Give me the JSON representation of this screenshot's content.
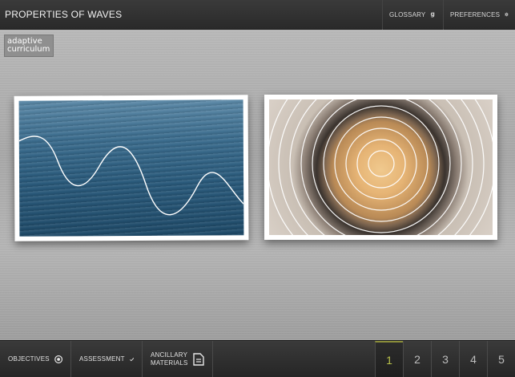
{
  "header": {
    "title": "PROPERTIES OF WAVES",
    "glossary_label": "GLOSSARY",
    "preferences_label": "PREFERENCES",
    "glossary_icon": "glossary-g-icon",
    "preferences_icon": "gear-icon"
  },
  "logo": {
    "line1": "adaptive",
    "line2": "curriculum"
  },
  "content": {
    "images": [
      {
        "name": "ocean-wave-photo",
        "description_icon": "sine-wave-overlay"
      },
      {
        "name": "speaker-sound-waves-photo",
        "description_icon": "concentric-rings-overlay"
      }
    ]
  },
  "footer": {
    "objectives_label": "OBJECTIVES",
    "assessment_label": "ASSESSMENT",
    "ancillary_line1": "ANCILLARY",
    "ancillary_line2": "MATERIALS",
    "pages": [
      "1",
      "2",
      "3",
      "4",
      "5"
    ],
    "active_page": "1"
  },
  "colors": {
    "active_page": "#b9c24a",
    "bar_bg": "#2f2f2f"
  }
}
